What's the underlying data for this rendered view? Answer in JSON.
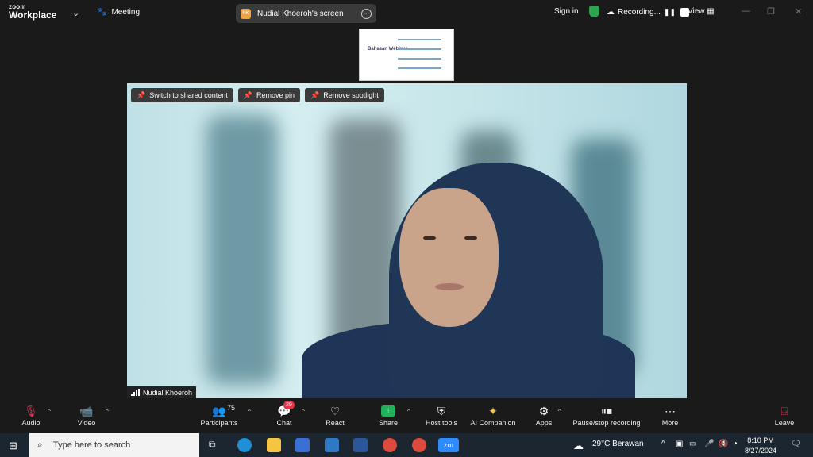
{
  "app": {
    "logo_line1": "zoom",
    "logo_line2": "Workplace",
    "meeting_label": "Meeting"
  },
  "share_pill": {
    "initials": "NK",
    "title": "Nudial Khoeroh's screen"
  },
  "top_right": {
    "sign_in": "Sign in",
    "recording": "Recording...",
    "view": "View"
  },
  "thumbnail": {
    "title": "Bahasan Webinar"
  },
  "video_buttons": {
    "switch": "Switch to shared content",
    "remove_pin": "Remove pin",
    "remove_spotlight": "Remove spotlight"
  },
  "participant": {
    "name": "Nudial Khoeroh"
  },
  "toolbar": {
    "audio": "Audio",
    "video": "Video",
    "participants": "Participants",
    "participants_count": "75",
    "chat": "Chat",
    "chat_badge": "29",
    "react": "React",
    "share": "Share",
    "host_tools": "Host tools",
    "ai_companion": "AI Companion",
    "apps": "Apps",
    "pause_recording": "Pause/stop recording",
    "more": "More",
    "leave": "Leave"
  },
  "taskbar": {
    "search_placeholder": "Type here to search",
    "weather": "29°C  Berawan",
    "time": "8:10 PM",
    "date": "8/27/2024"
  },
  "colors": {
    "share_green": "#1fb25a",
    "leave_red": "#e0334c",
    "badge_red": "#e0334c",
    "nk_orange": "#f2a341"
  }
}
